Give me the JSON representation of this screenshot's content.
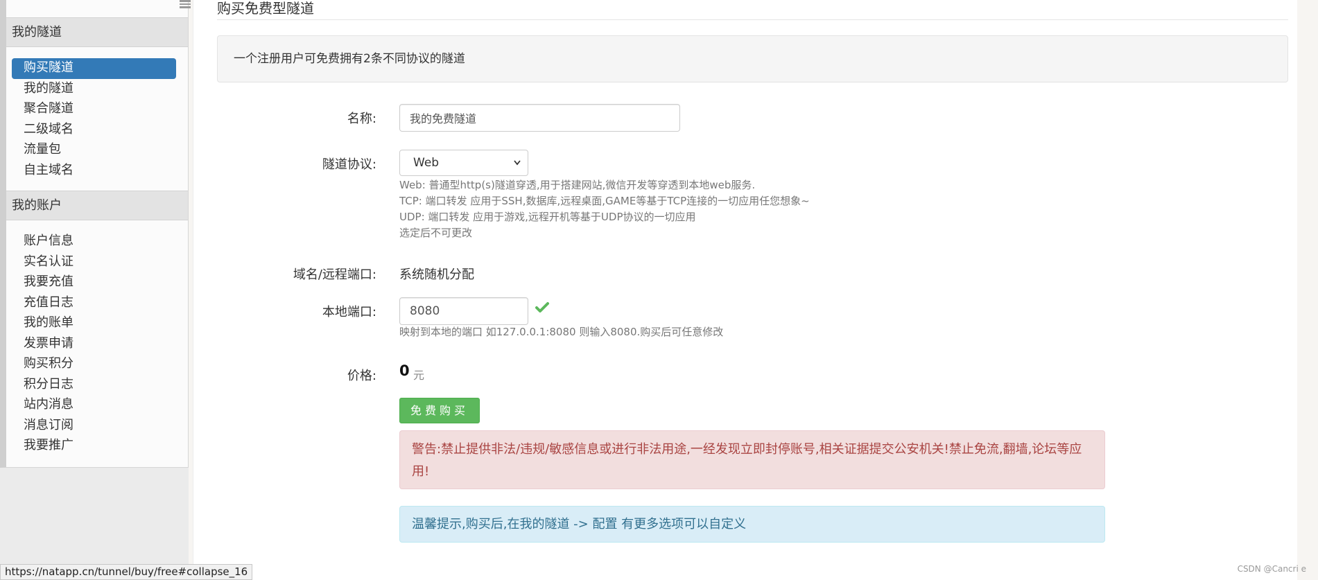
{
  "sidebar": {
    "section_tunnels": "我的隧道",
    "tunnel_items": [
      {
        "label": "购买隧道"
      },
      {
        "label": "我的隧道"
      },
      {
        "label": "聚合隧道"
      },
      {
        "label": "二级域名"
      },
      {
        "label": "流量包"
      },
      {
        "label": "自主域名"
      }
    ],
    "section_account": "我的账户",
    "account_items": [
      {
        "label": "账户信息"
      },
      {
        "label": "实名认证"
      },
      {
        "label": "我要充值"
      },
      {
        "label": "充值日志"
      },
      {
        "label": "我的账单"
      },
      {
        "label": "发票申请"
      },
      {
        "label": "购买积分"
      },
      {
        "label": "积分日志"
      },
      {
        "label": "站内消息"
      },
      {
        "label": "消息订阅"
      },
      {
        "label": "我要推广"
      }
    ]
  },
  "main": {
    "title": "购买免费型隧道",
    "info": "一个注册用户可免费拥有2条不同协议的隧道",
    "form": {
      "name_label": "名称:",
      "name_value": "我的免费隧道",
      "protocol_label": "隧道协议:",
      "protocol_selected": "Web",
      "protocol_help": [
        "Web: 普通型http(s)隧道穿透,用于搭建网站,微信开发等穿透到本地web服务.",
        "TCP: 端口转发 应用于SSH,数据库,远程桌面,GAME等基于TCP连接的一切应用任您想象~",
        "UDP: 端口转发 应用于游戏,远程开机等基于UDP协议的一切应用",
        "选定后不可更改"
      ],
      "domain_label": "域名/远程端口:",
      "domain_value": "系统随机分配",
      "local_port_label": "本地端口:",
      "local_port_value": "8080",
      "local_port_help": "映射到本地的端口 如127.0.0.1:8080 则输入8080.购买后可任意修改",
      "price_label": "价格:",
      "price_value": "0",
      "price_unit": "元",
      "buy_button": "免费购买"
    },
    "warning": "警告:禁止提供非法/违规/敏感信息或进行非法用途,一经发现立即封停账号,相关证据提交公安机关!禁止免流,翻墙,论坛等应用!",
    "tip": "温馨提示,购买后,在我的隧道 -> 配置 有更多选项可以自定义"
  },
  "status_bar": {
    "url": "https://natapp.cn/tunnel/buy/free#collapse_16"
  },
  "watermark": "CSDN @Cancri e",
  "colors": {
    "active_item": "#337ab7",
    "buy_button": "#5cb85c",
    "warning_bg": "#f2dede",
    "warning_text": "#a94442",
    "info_bg": "#d9edf7",
    "info_text": "#31708f",
    "check_icon": "#5cb85c"
  }
}
